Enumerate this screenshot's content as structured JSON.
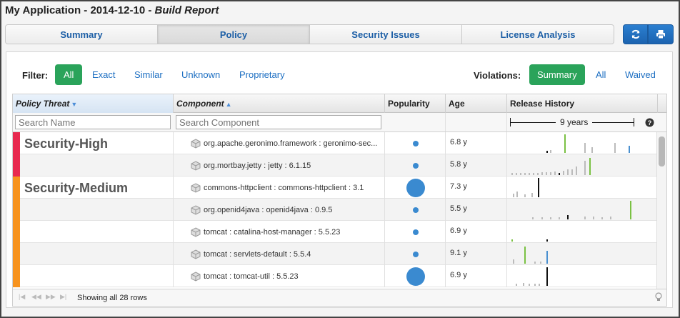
{
  "app_title_prefix": "My Application - 2014-12-10 - ",
  "app_title_suffix": "Build Report",
  "tabs": [
    {
      "label": "Summary",
      "active": false
    },
    {
      "label": "Policy",
      "active": true
    },
    {
      "label": "Security Issues",
      "active": false
    },
    {
      "label": "License Analysis",
      "active": false
    }
  ],
  "toolbar_icons": [
    "refresh-icon",
    "print-icon"
  ],
  "filter": {
    "label": "Filter:",
    "options": [
      "All",
      "Exact",
      "Similar",
      "Unknown",
      "Proprietary"
    ],
    "selected": "All"
  },
  "violations": {
    "label": "Violations:",
    "options": [
      "Summary",
      "All",
      "Waived"
    ],
    "selected": "Summary"
  },
  "columns": {
    "threat": "Policy Threat",
    "component": "Component",
    "popularity": "Popularity",
    "age": "Age",
    "history": "Release History"
  },
  "search": {
    "name_placeholder": "Search Name",
    "component_placeholder": "Search Component"
  },
  "history_span": "9 years",
  "groups": [
    {
      "name": "Security-High",
      "color": "#e8294f"
    },
    {
      "name": "Security-Medium",
      "color": "#f7931e"
    }
  ],
  "rows": [
    {
      "component": "org.apache.geronimo.framework : geronimo-sec...",
      "popularity": 0.08,
      "age": "6.8 y"
    },
    {
      "component": "org.mortbay.jetty : jetty : 6.1.15",
      "popularity": 0.08,
      "age": "5.8 y"
    },
    {
      "component": "commons-httpclient : commons-httpclient : 3.1",
      "popularity": 1.0,
      "age": "7.3 y"
    },
    {
      "component": "org.openid4java : openid4java : 0.9.5",
      "popularity": 0.08,
      "age": "5.5 y"
    },
    {
      "component": "tomcat : catalina-host-manager : 5.5.23",
      "popularity": 0.08,
      "age": "6.9 y"
    },
    {
      "component": "tomcat : servlets-default : 5.5.4",
      "popularity": 0.08,
      "age": "9.1 y"
    },
    {
      "component": "tomcat : tomcat-util : 5.5.23",
      "popularity": 1.0,
      "age": "6.9 y"
    }
  ],
  "status_text": "Showing all 28 rows",
  "colors": {
    "accent_green": "#2aa35a",
    "link_blue": "#1d6fc2",
    "security_high": "#e8294f",
    "security_medium": "#f7931e",
    "release_used": "#111111",
    "release_latest_ok": "#7ac143",
    "release_next": "#4a90d0",
    "release_other": "#bbbbbb"
  }
}
